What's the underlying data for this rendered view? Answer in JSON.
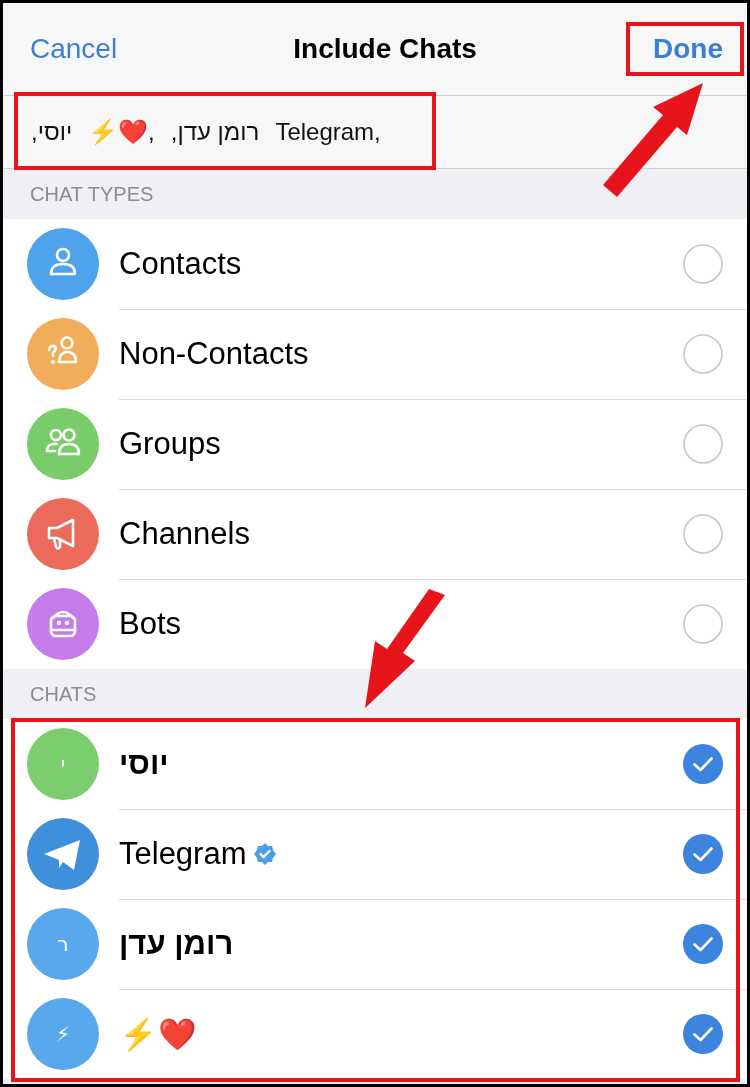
{
  "nav": {
    "cancel": "Cancel",
    "title": "Include Chats",
    "done": "Done"
  },
  "selected_tokens": [
    "יוסי,",
    "⚡❤️,",
    "רומן עדן,",
    "Telegram,"
  ],
  "sections": [
    {
      "header": "CHAT TYPES",
      "items": [
        {
          "name": "Contacts",
          "kind": "contact",
          "color": "#4fa3ec",
          "checked": false
        },
        {
          "name": "Non-Contacts",
          "kind": "non-contact",
          "color": "#f2ad5a",
          "checked": false
        },
        {
          "name": "Groups",
          "kind": "group",
          "color": "#79cc6a",
          "checked": false
        },
        {
          "name": "Channels",
          "kind": "channel",
          "color": "#ec6a5c",
          "checked": false
        },
        {
          "name": "Bots",
          "kind": "bot",
          "color": "#c57be8",
          "checked": false
        }
      ]
    },
    {
      "header": "CHATS",
      "items": [
        {
          "name": "יוסי",
          "kind": "letter",
          "letter": "י",
          "color": "#7ccd6d",
          "checked": true,
          "bold": true
        },
        {
          "name": "Telegram",
          "kind": "telegram",
          "color": "#3e8fdc",
          "checked": true,
          "verified": true
        },
        {
          "name": "רומן עדן",
          "kind": "letter",
          "letter": "ר",
          "color": "#5aa8ec",
          "checked": true,
          "bold": true
        },
        {
          "name": "⚡❤️",
          "kind": "letter",
          "letter": "⚡",
          "color": "#5aa8ec",
          "checked": true
        }
      ]
    }
  ]
}
